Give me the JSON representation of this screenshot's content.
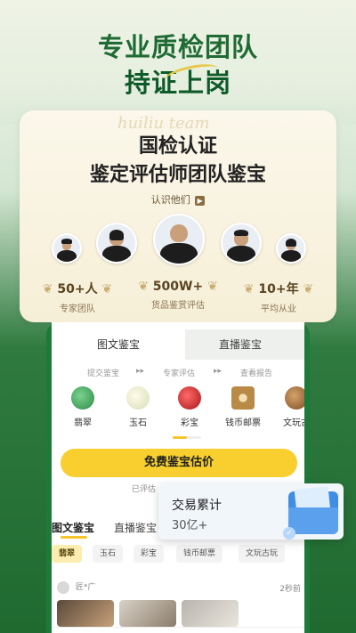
{
  "header": {
    "line1": "专业质检团队",
    "line2": "持证上岗"
  },
  "cert_card": {
    "script": "huiliu team",
    "title1": "国检认证",
    "title2": "鉴定评估师团队鉴宝",
    "know_link": "认识他们",
    "stats": [
      {
        "value": "50+人",
        "label": "专家团队"
      },
      {
        "value": "500W+",
        "label": "货品鉴赏评估"
      },
      {
        "value": "10+年",
        "label": "平均从业"
      }
    ]
  },
  "app": {
    "tabs": [
      "图文鉴宝",
      "直播鉴宝"
    ],
    "steps": [
      "提交鉴宝",
      "专家评估",
      "查看报告"
    ],
    "categories": [
      {
        "label": "翡翠",
        "icon": "jade-pendant-icon",
        "color": "#3aa35a"
      },
      {
        "label": "玉石",
        "icon": "jade-stone-icon",
        "color": "#e9efd2"
      },
      {
        "label": "彩宝",
        "icon": "ruby-icon",
        "color": "#c82a2a"
      },
      {
        "label": "钱币邮票",
        "icon": "coin-icon",
        "color": "#b88a45"
      },
      {
        "label": "文玩古",
        "icon": "antique-icon",
        "color": "#a06b3a"
      }
    ],
    "cta_label": "免费鉴宝估价",
    "hint": "已评估",
    "sub_tabs": [
      "图文鉴宝",
      "直播鉴宝"
    ],
    "filters": [
      "翡翠",
      "玉石",
      "彩宝",
      "钱币邮票",
      "文玩古玩"
    ],
    "feed_user": "匠*广",
    "feed_time": "2秒前"
  },
  "trade_card": {
    "title": "交易累计",
    "value": "30亿+"
  },
  "colors": {
    "brand_green": "#1f6b33",
    "cta_yellow": "#f8cf2e",
    "accent_blue": "#3f8ee4"
  }
}
